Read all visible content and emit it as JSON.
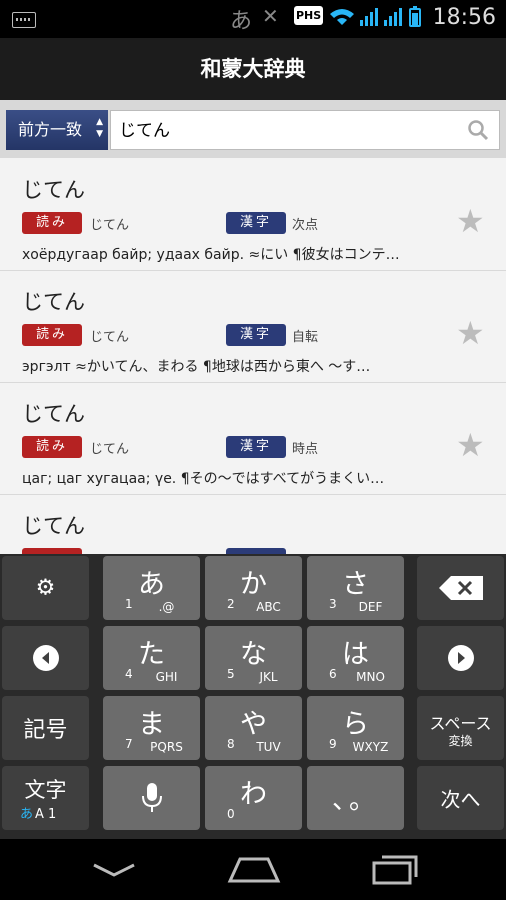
{
  "status": {
    "ime": "あ",
    "phs": "PHS",
    "time": "18:56"
  },
  "app": {
    "title": "和蒙大辞典"
  },
  "search": {
    "mode": "前方一致",
    "query": "じてん"
  },
  "entries": [
    {
      "word": "じてん",
      "yomi_label": "読み",
      "reading": "じてん",
      "kanji_label": "漢字",
      "kanji": "次点",
      "definition": "хоёрдугаар байр; удаах байр. ≈にい ¶彼女はコンテ…"
    },
    {
      "word": "じてん",
      "yomi_label": "読み",
      "reading": "じてん",
      "kanji_label": "漢字",
      "kanji": "自転",
      "definition": "эргэлт ≈かいてん、まわる ¶地球は西から東へ ～す…"
    },
    {
      "word": "じてん",
      "yomi_label": "読み",
      "reading": "じてん",
      "kanji_label": "漢字",
      "kanji": "時点",
      "definition": "цаг; цаг хугацаа; үе. ¶その～ではすべてがうまくい…"
    },
    {
      "word": "じてん"
    }
  ],
  "keyboard": {
    "keys": [
      {
        "main": "あ",
        "num": "1",
        "sub": ".@"
      },
      {
        "main": "か",
        "num": "2",
        "sub": "ABC"
      },
      {
        "main": "さ",
        "num": "3",
        "sub": "DEF"
      },
      {
        "main": "た",
        "num": "4",
        "sub": "GHI"
      },
      {
        "main": "な",
        "num": "5",
        "sub": "JKL"
      },
      {
        "main": "は",
        "num": "6",
        "sub": "MNO"
      },
      {
        "main": "ま",
        "num": "7",
        "sub": "PQRS"
      },
      {
        "main": "や",
        "num": "8",
        "sub": "TUV"
      },
      {
        "main": "ら",
        "num": "9",
        "sub": "WXYZ"
      },
      {
        "main": "わ",
        "num": "0",
        "sub": ""
      }
    ],
    "punct": "、。",
    "symbols": "記号",
    "space_label": "スペース",
    "space_sub": "変換",
    "mode_label": "文字",
    "mode_sub_kana": "あ",
    "mode_sub_alpha": "A 1",
    "next_label": "次へ"
  }
}
